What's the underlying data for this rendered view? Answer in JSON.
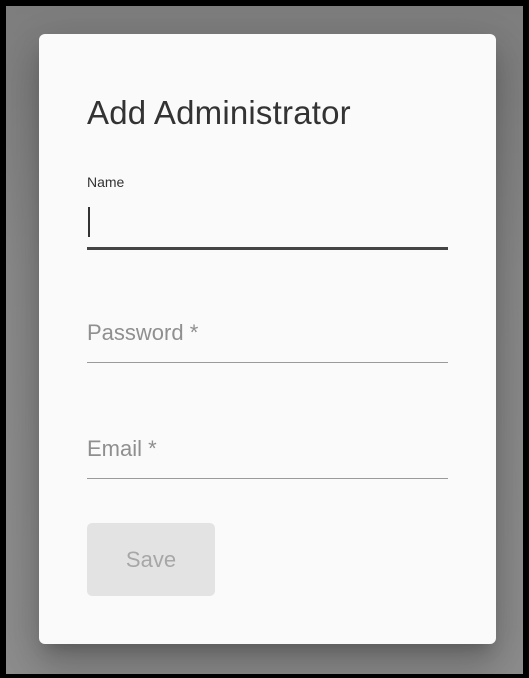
{
  "dialog": {
    "title": "Add Administrator",
    "fields": {
      "name": {
        "label": "Name",
        "value": ""
      },
      "password": {
        "label": "Password *",
        "value": ""
      },
      "email": {
        "label": "Email *",
        "value": ""
      }
    },
    "save_label": "Save"
  },
  "colors": {
    "backdrop": "#8a8a8a",
    "dialog_bg": "#fafafa",
    "text": "#333333",
    "placeholder": "#8f8f8f",
    "button_disabled_bg": "#e3e3e3",
    "button_disabled_text": "#a7a7a7"
  }
}
